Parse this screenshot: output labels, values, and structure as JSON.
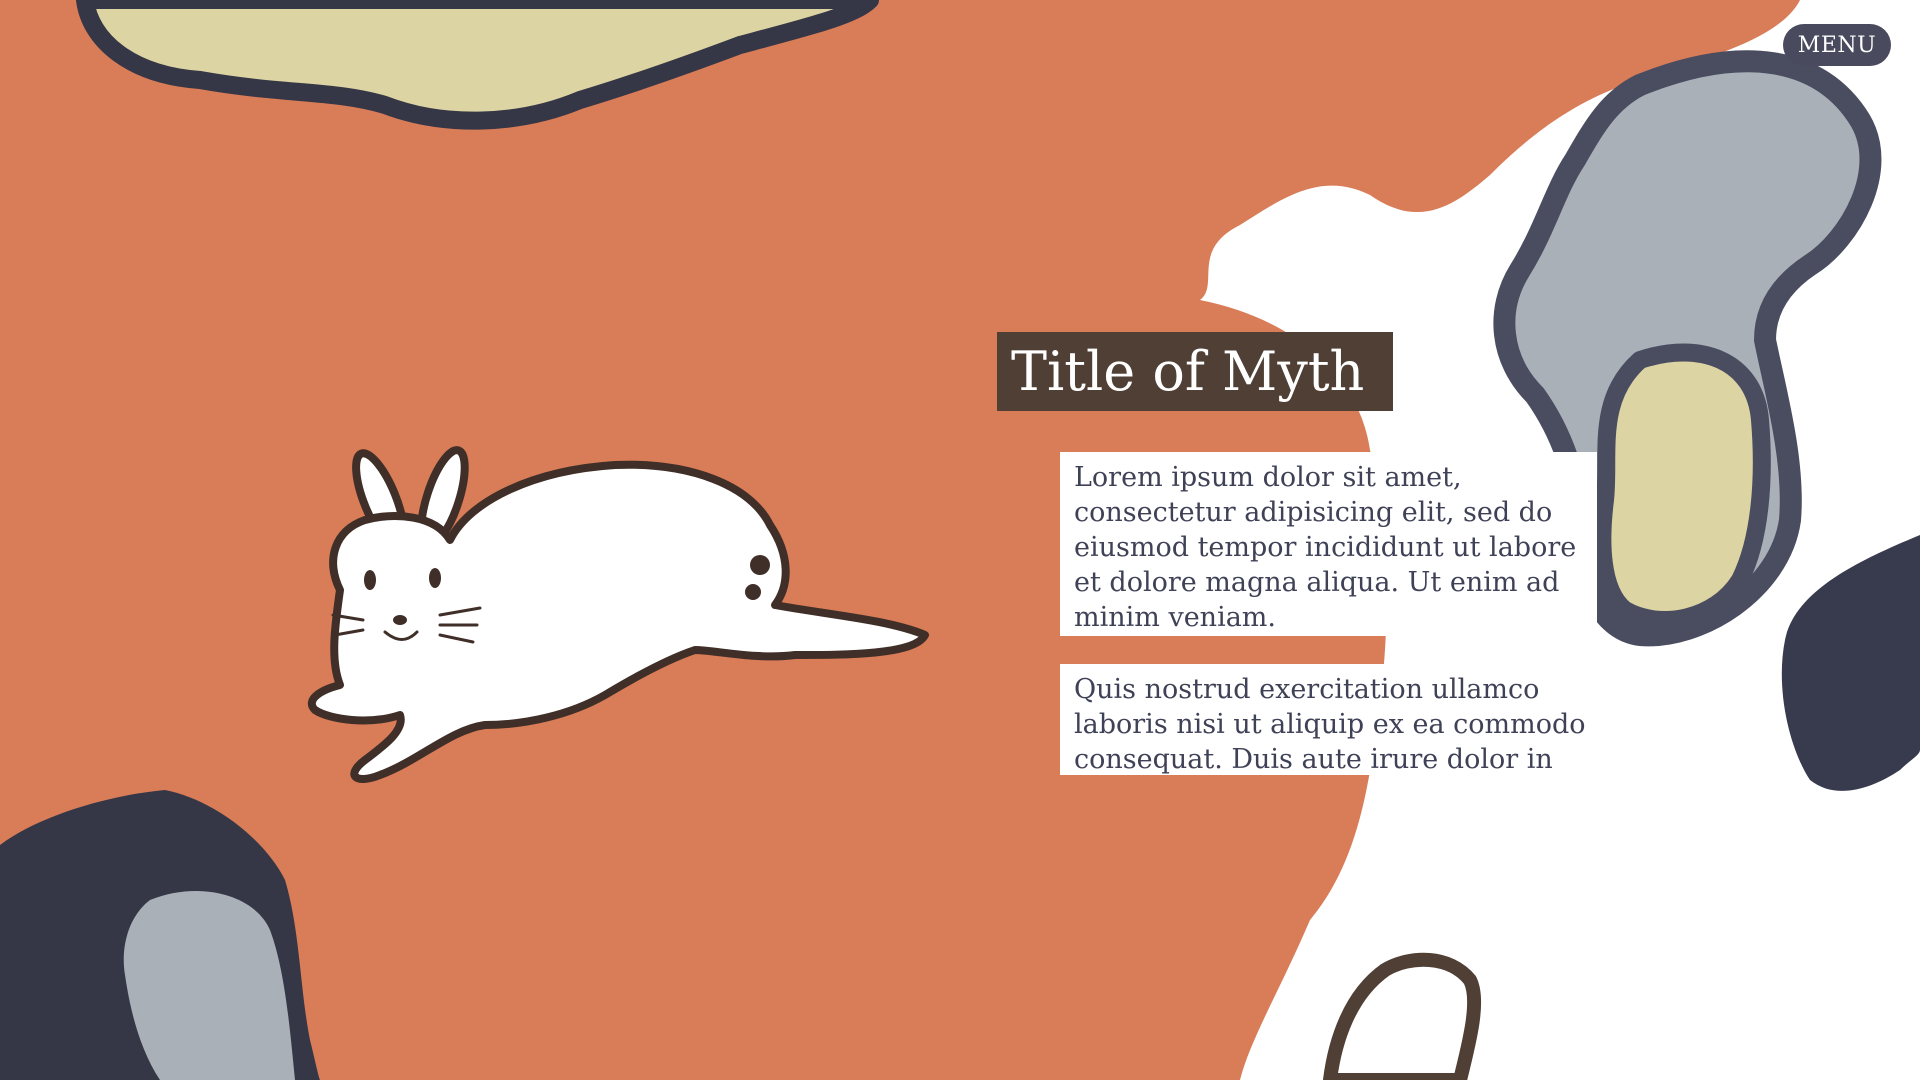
{
  "header": {
    "menu_label": "MENU"
  },
  "story": {
    "title": "Title of Myth",
    "paragraphs": [
      "Lorem ipsum dolor sit amet, consectetur adipisicing elit, sed do eiusmod tempor incididunt ut labore et dolore magna aliqua. Ut enim ad minim veniam.",
      "Quis nostrud exercitation ullamco laboris nisi ut aliquip ex ea commodo consequat. Duis aute irure dolor in"
    ]
  },
  "illustration": {
    "subject": "leaping white rabbit",
    "icon": "rabbit-illustration"
  },
  "colors": {
    "terracotta": "#d97c58",
    "sand": "#ddd4a3",
    "slate_gray": "#a9b0b7",
    "ink_navy": "#353646",
    "title_bg": "#4f3f35",
    "menu_bg": "#494a5d",
    "text": "#3f4257"
  }
}
